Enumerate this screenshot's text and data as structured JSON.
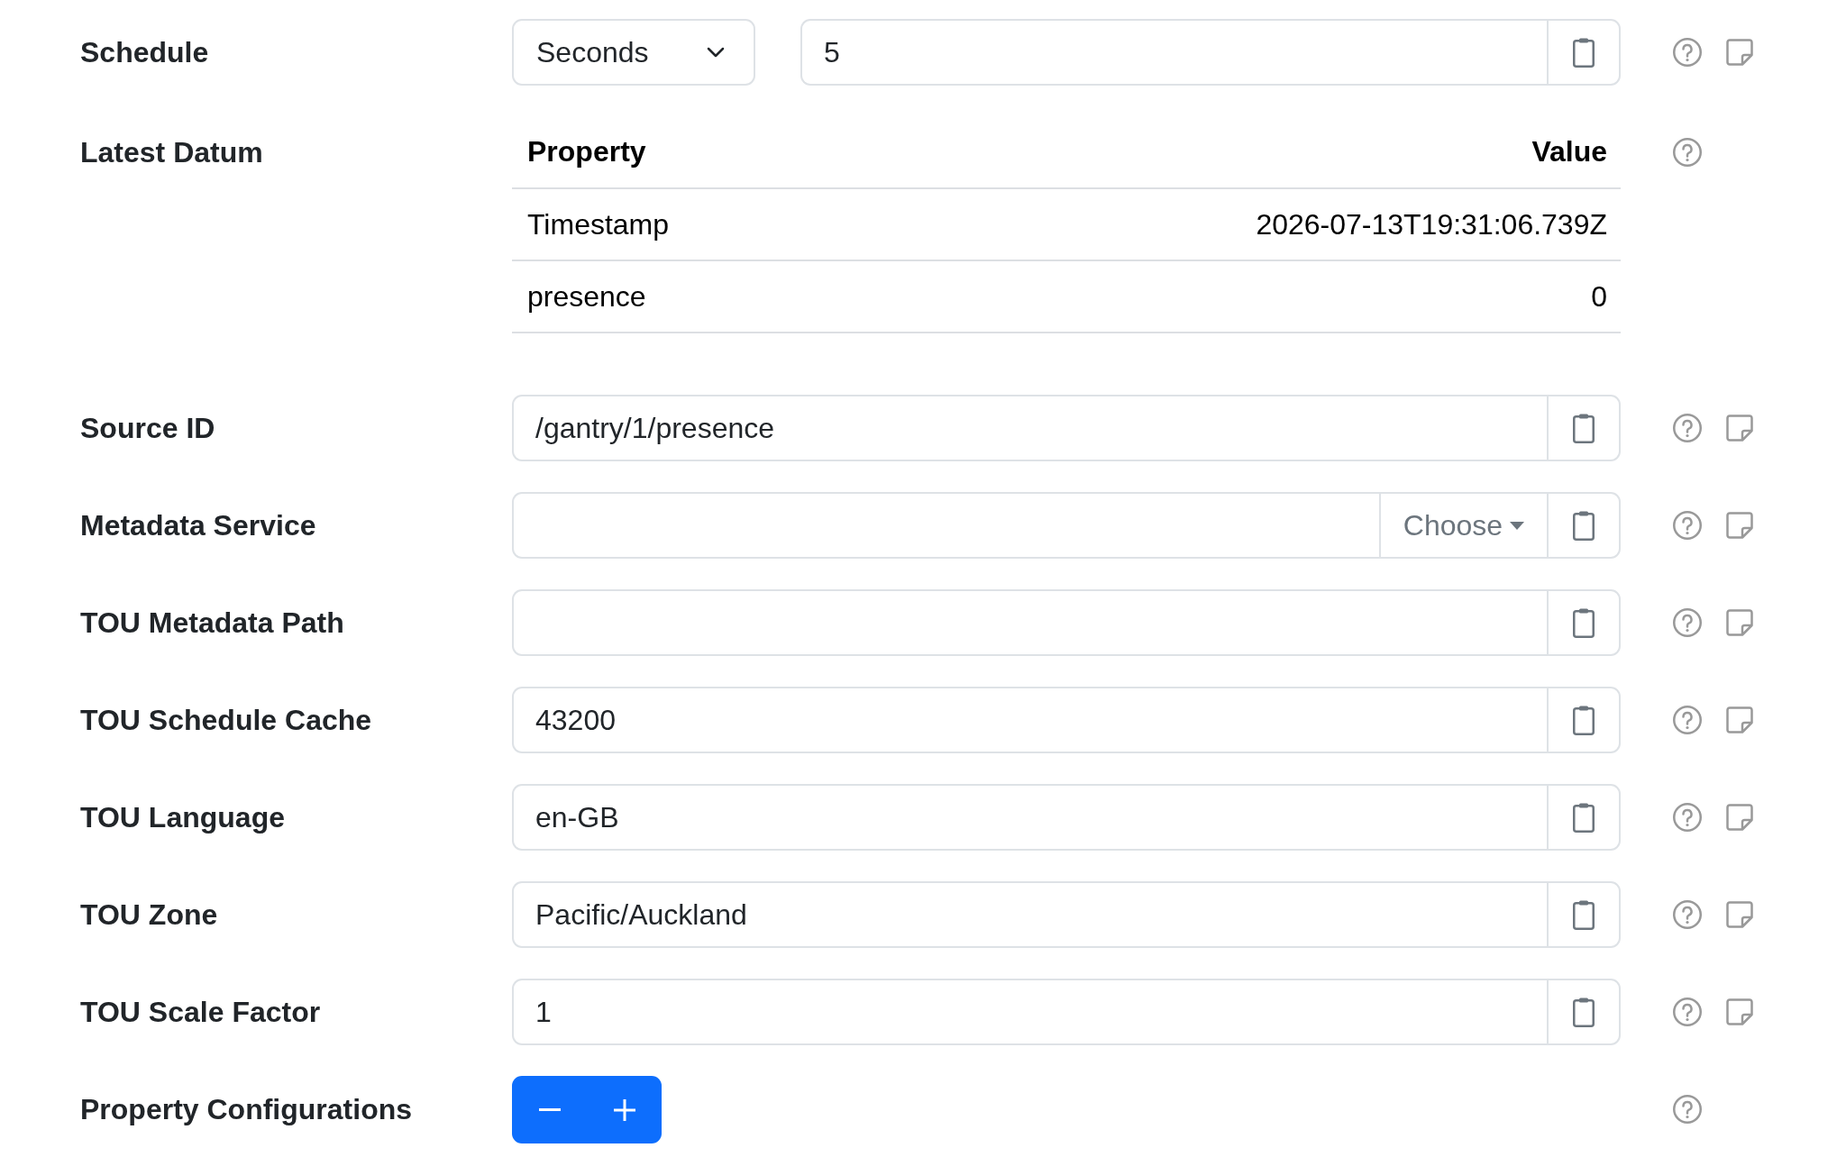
{
  "rows": [
    {
      "kind": "schedule",
      "label": "Schedule",
      "unit": "Seconds",
      "value": "5"
    },
    {
      "kind": "datum",
      "label": "Latest Datum",
      "columns": [
        "Property",
        "Value"
      ],
      "data": [
        {
          "property": "Timestamp",
          "value": "2026-07-13T19:31:06.739Z"
        },
        {
          "property": "presence",
          "value": "0"
        }
      ]
    },
    {
      "kind": "text",
      "label": "Source ID",
      "value": "/gantry/1/presence"
    },
    {
      "kind": "choose",
      "label": "Metadata Service",
      "button": "Choose"
    },
    {
      "kind": "text",
      "label": "TOU Metadata Path"
    },
    {
      "kind": "text",
      "label": "TOU Schedule Cache",
      "value": "43200"
    },
    {
      "kind": "text",
      "label": "TOU Language",
      "value": "en-GB"
    },
    {
      "kind": "text",
      "label": "TOU Zone",
      "value": "Pacific/Auckland"
    },
    {
      "kind": "text",
      "label": "TOU Scale Factor",
      "value": "1"
    },
    {
      "kind": "stepper",
      "label": "Property Configurations"
    }
  ]
}
